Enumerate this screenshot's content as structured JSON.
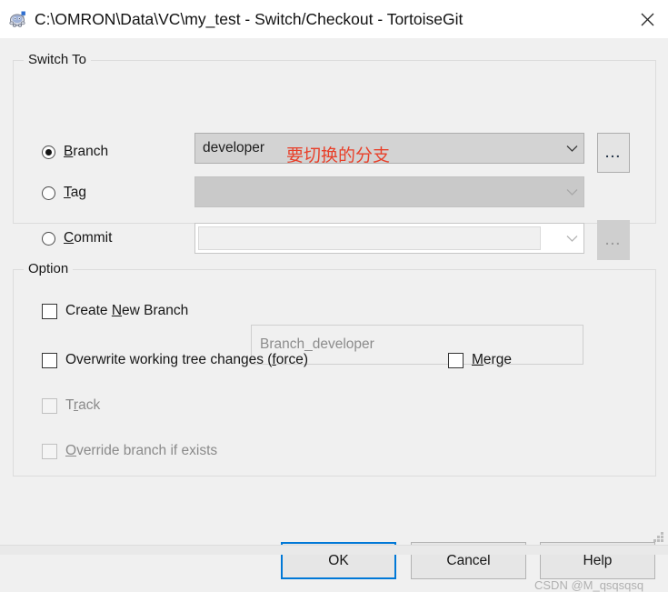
{
  "window": {
    "title": "C:\\OMRON\\Data\\VC\\my_test - Switch/Checkout - TortoiseGit",
    "app_icon": "tortoisegit-turtle-icon",
    "close_label": "✕"
  },
  "switch_to": {
    "group_title": "Switch To",
    "options": [
      {
        "label_pre": "",
        "accel": "B",
        "label_post": "ranch",
        "checked": true,
        "name": "branch"
      },
      {
        "label_pre": "",
        "accel": "T",
        "label_post": "ag",
        "checked": false,
        "name": "tag"
      },
      {
        "label_pre": "",
        "accel": "C",
        "label_post": "ommit",
        "checked": false,
        "name": "commit"
      }
    ],
    "branch_combo_value": "developer",
    "tag_combo_value": "",
    "commit_combo_value": "",
    "browse_button_label": "...",
    "dropdown_icon": "chevron-down-icon"
  },
  "annotation": {
    "text": "要切换的分支",
    "color": "#e8402a"
  },
  "option": {
    "group_title": "Option",
    "create_new_branch": {
      "label_pre": "Create ",
      "accel": "N",
      "label_post": "ew Branch",
      "checked": false,
      "enabled": true
    },
    "new_branch_placeholder": "Branch_developer",
    "overwrite": {
      "label_pre": "Overwrite working tree changes (",
      "accel": "f",
      "label_post": "orce)",
      "checked": false,
      "enabled": true
    },
    "merge": {
      "label_pre": "",
      "accel": "M",
      "label_post": "erge",
      "checked": false,
      "enabled": true
    },
    "track": {
      "label_pre": "T",
      "accel": "r",
      "label_post": "ack",
      "checked": false,
      "enabled": false
    },
    "override": {
      "label_pre": "",
      "accel": "O",
      "label_post": "verride branch if exists",
      "checked": false,
      "enabled": false
    }
  },
  "buttons": {
    "ok": "OK",
    "cancel": "Cancel",
    "help": "Help",
    "focus_color": "#0078d7"
  },
  "watermark": {
    "text": "CSDN @M_qsqsqsq"
  }
}
